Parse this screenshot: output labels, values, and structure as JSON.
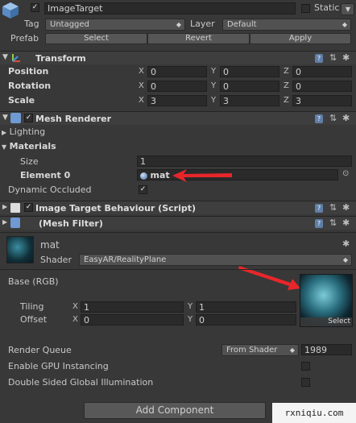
{
  "header": {
    "object_name": "ImageTarget",
    "static_label": "Static",
    "tag_label": "Tag",
    "tag_value": "Untagged",
    "layer_label": "Layer",
    "layer_value": "Default",
    "prefab_label": "Prefab",
    "select_button": "Select",
    "revert_button": "Revert",
    "apply_button": "Apply"
  },
  "transform": {
    "title": "Transform",
    "rows": [
      {
        "label": "Position",
        "x": "0",
        "y": "0",
        "z": "0"
      },
      {
        "label": "Rotation",
        "x": "0",
        "y": "0",
        "z": "0"
      },
      {
        "label": "Scale",
        "x": "3",
        "y": "3",
        "z": "3"
      }
    ],
    "axis_x": "X",
    "axis_y": "Y",
    "axis_z": "Z"
  },
  "mesh_renderer": {
    "title": "Mesh Renderer",
    "lighting_label": "Lighting",
    "materials_label": "Materials",
    "size_label": "Size",
    "size_value": "1",
    "element0_label": "Element 0",
    "element0_value": "mat",
    "dynamic_occluded_label": "Dynamic Occluded",
    "dynamic_occluded_checked": true
  },
  "image_target_behaviour": {
    "title": "Image Target Behaviour (Script)"
  },
  "mesh_filter": {
    "title": "(Mesh Filter)"
  },
  "material": {
    "name": "mat",
    "shader_label": "Shader",
    "shader_value": "EasyAR/RealityPlane",
    "base_label": "Base (RGB)",
    "tiling_label": "Tiling",
    "tiling_x": "1",
    "tiling_y": "1",
    "offset_label": "Offset",
    "offset_x": "0",
    "offset_y": "0",
    "texture_select": "Select",
    "render_queue_label": "Render Queue",
    "render_queue_mode": "From Shader",
    "render_queue_value": "1989",
    "gpu_instancing_label": "Enable GPU Instancing",
    "double_sided_label": "Double Sided Global Illumination"
  },
  "footer": {
    "add_component_button": "Add Component",
    "watermark": "rxniqiu.com"
  },
  "colors": {
    "background": "#383838",
    "annotation_arrow": "#e8262a"
  }
}
